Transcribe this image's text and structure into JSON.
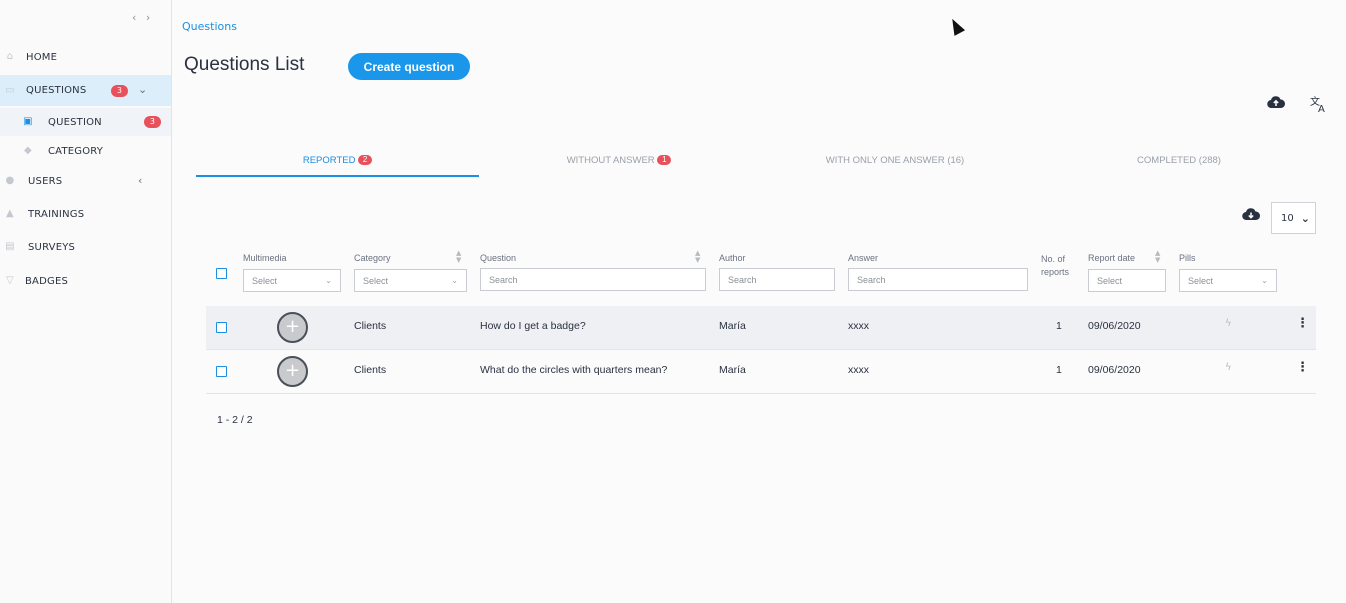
{
  "sidebar": {
    "collapse_icon": "‹ ›",
    "items": [
      {
        "icon": "home-icon",
        "glyph": "⌂",
        "label": "HOME"
      },
      {
        "icon": "questions-icon",
        "glyph": "▭",
        "label": "QUESTIONS",
        "badge": "3"
      },
      {
        "icon": "question-icon",
        "glyph": "▣",
        "label": "QUESTION",
        "badge": "3"
      },
      {
        "icon": "category-icon",
        "glyph": "◆",
        "label": "CATEGORY"
      },
      {
        "icon": "users-icon",
        "glyph": "●",
        "label": "USERS"
      },
      {
        "icon": "trainings-icon",
        "glyph": "▲",
        "label": "TRAININGS"
      },
      {
        "icon": "surveys-icon",
        "glyph": "▤",
        "label": "SURVEYS"
      },
      {
        "icon": "badges-icon",
        "glyph": "▽",
        "label": "BADGES"
      }
    ]
  },
  "header": {
    "breadcrumb": "Questions",
    "title": "Questions List",
    "create_button": "Create question",
    "upload_icon": "cloud-upload-icon",
    "translate_icon": "translate-icon"
  },
  "tabs": [
    {
      "label": "REPORTED",
      "badge": "2",
      "active": true
    },
    {
      "label": "WITHOUT ANSWER",
      "badge": "1",
      "active": false
    },
    {
      "label": "WITH ONLY ONE ANSWER (16)",
      "active": false
    },
    {
      "label": "COMPLETED (288)",
      "active": false
    }
  ],
  "table": {
    "page_size": "10",
    "download_icon": "cloud-download-icon",
    "columns": [
      {
        "label": "Multimedia",
        "filter_type": "select",
        "filter_placeholder": "Select"
      },
      {
        "label": "Category",
        "filter_type": "select",
        "filter_placeholder": "Select",
        "sortable": true
      },
      {
        "label": "Question",
        "filter_type": "search",
        "filter_placeholder": "Search",
        "sortable": true
      },
      {
        "label": "Author",
        "filter_type": "search",
        "filter_placeholder": "Search"
      },
      {
        "label": "Answer",
        "filter_type": "search",
        "filter_placeholder": "Search"
      },
      {
        "label": "No. of reports"
      },
      {
        "label": "Report date",
        "filter_type": "select",
        "filter_placeholder": "Select",
        "sortable": true
      },
      {
        "label": "Pills",
        "filter_type": "select",
        "filter_placeholder": "Select"
      }
    ],
    "rows": [
      {
        "category": "Clients",
        "question": "How do I get a badge?",
        "author": "María",
        "answer": "xxxx",
        "reports": "1",
        "date": "09/06/2020"
      },
      {
        "category": "Clients",
        "question": "What do the circles with quarters mean?",
        "author": "María",
        "answer": "xxxx",
        "reports": "1",
        "date": "09/06/2020"
      }
    ],
    "pagination": "1 - 2 / 2"
  },
  "colors": {
    "accent": "#1a97ea",
    "badge": "#e8505b",
    "active_nav_bg": "#dbeefa"
  }
}
